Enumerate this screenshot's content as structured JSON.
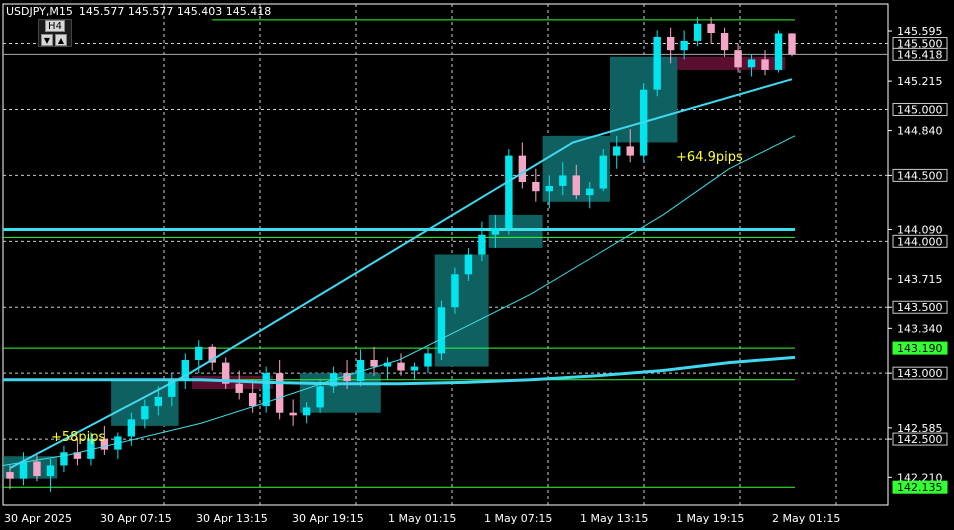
{
  "header": {
    "symbol_line": "USDJPY,M15",
    "ohlc": "145.577 145.577 145.403 145.418"
  },
  "timeframe_box": {
    "label": "H4",
    "down_arrow": "▼",
    "up_arrow": "▲"
  },
  "colors": {
    "background": "#000000",
    "bull_candle": "#00e5ee",
    "bear_candle": "#f4a6c6",
    "ma_fast": "#40d8f0",
    "ma_slow": "#3ae0e8",
    "level_line": "#33ff33",
    "teal_zone": "#0f6060",
    "magenta_zone": "#5a0f30",
    "label_yellow": "#ffff33"
  },
  "annotations": [
    {
      "text": "+58pips"
    },
    {
      "text": "+64.9pips"
    }
  ],
  "chart_data": {
    "type": "candlestick",
    "symbol": "USDJPY",
    "timeframe": "M15",
    "ylim": [
      142.0,
      145.8
    ],
    "price_ticks": [
      "145.595",
      "145.215",
      "144.840",
      "144.500",
      "144.090",
      "143.715",
      "143.500",
      "143.340",
      "143.000",
      "142.585",
      "142.500",
      "142.210"
    ],
    "price_tags": [
      {
        "value": "145.500",
        "style": "box-gray"
      },
      {
        "value": "145.418",
        "style": "box-gray"
      },
      {
        "value": "145.000",
        "style": "box-gray"
      },
      {
        "value": "144.500",
        "style": "box-gray"
      },
      {
        "value": "144.000",
        "style": "box-gray"
      },
      {
        "value": "143.500",
        "style": "box-gray"
      },
      {
        "value": "143.190",
        "style": "box-green"
      },
      {
        "value": "143.000",
        "style": "box-gray"
      },
      {
        "value": "142.500",
        "style": "box-gray"
      },
      {
        "value": "142.135",
        "style": "box-green"
      }
    ],
    "time_labels": [
      "30 Apr 2025",
      "30 Apr 07:15",
      "30 Apr 13:15",
      "30 Apr 19:15",
      "1 May 01:15",
      "1 May 07:15",
      "1 May 13:15",
      "1 May 19:15",
      "2 May 01:15"
    ],
    "levels": [
      {
        "price": 145.68,
        "kind": "green",
        "from": 5
      },
      {
        "price": 144.09,
        "kind": "cyan-thick"
      },
      {
        "price": 144.03,
        "kind": "green"
      },
      {
        "price": 143.19,
        "kind": "green"
      },
      {
        "price": 142.95,
        "kind": "green"
      },
      {
        "price": 142.135,
        "kind": "green"
      }
    ],
    "dashed_levels": [
      145.5,
      145.0,
      144.5,
      144.0,
      143.5,
      143.0,
      142.5
    ],
    "day_separator_x_index": 5,
    "candles_ohlc": [
      [
        142.25,
        142.3,
        142.12,
        142.2
      ],
      [
        142.2,
        142.4,
        142.15,
        142.33
      ],
      [
        142.33,
        142.38,
        142.18,
        142.22
      ],
      [
        142.22,
        142.35,
        142.1,
        142.3
      ],
      [
        142.3,
        142.45,
        142.25,
        142.4
      ],
      [
        142.4,
        142.5,
        142.3,
        142.35
      ],
      [
        142.35,
        142.55,
        142.3,
        142.5
      ],
      [
        142.5,
        142.6,
        142.38,
        142.42
      ],
      [
        142.42,
        142.55,
        142.35,
        142.52
      ],
      [
        142.52,
        142.7,
        142.45,
        142.65
      ],
      [
        142.65,
        142.8,
        142.58,
        142.75
      ],
      [
        142.75,
        142.9,
        142.68,
        142.82
      ],
      [
        142.82,
        143.0,
        142.75,
        142.95
      ],
      [
        142.95,
        143.15,
        142.88,
        143.1
      ],
      [
        143.1,
        143.25,
        143.0,
        143.2
      ],
      [
        143.2,
        143.22,
        143.02,
        143.08
      ],
      [
        143.08,
        143.12,
        142.88,
        142.92
      ],
      [
        142.92,
        143.02,
        142.8,
        142.85
      ],
      [
        142.85,
        142.95,
        142.7,
        142.75
      ],
      [
        142.75,
        143.05,
        142.7,
        143.0
      ],
      [
        143.0,
        143.1,
        142.65,
        142.7
      ],
      [
        142.7,
        142.8,
        142.6,
        142.68
      ],
      [
        142.68,
        142.78,
        142.62,
        142.74
      ],
      [
        142.74,
        142.95,
        142.7,
        142.9
      ],
      [
        142.9,
        143.05,
        142.85,
        143.0
      ],
      [
        143.0,
        143.1,
        142.88,
        142.94
      ],
      [
        142.94,
        143.18,
        142.9,
        143.1
      ],
      [
        143.1,
        143.2,
        142.98,
        143.05
      ],
      [
        143.05,
        143.12,
        142.95,
        143.08
      ],
      [
        143.08,
        143.15,
        142.98,
        143.02
      ],
      [
        143.02,
        143.08,
        142.95,
        143.05
      ],
      [
        143.05,
        143.2,
        143.0,
        143.15
      ],
      [
        143.15,
        143.55,
        143.1,
        143.5
      ],
      [
        143.5,
        143.8,
        143.45,
        143.75
      ],
      [
        143.75,
        143.95,
        143.7,
        143.9
      ],
      [
        143.9,
        144.15,
        143.85,
        144.05
      ],
      [
        144.05,
        144.2,
        143.95,
        144.1
      ],
      [
        144.1,
        144.7,
        144.05,
        144.65
      ],
      [
        144.65,
        144.75,
        144.4,
        144.45
      ],
      [
        144.45,
        144.55,
        144.3,
        144.38
      ],
      [
        144.38,
        144.5,
        144.25,
        144.42
      ],
      [
        144.42,
        144.6,
        144.35,
        144.5
      ],
      [
        144.5,
        144.58,
        144.32,
        144.35
      ],
      [
        144.35,
        144.45,
        144.25,
        144.4
      ],
      [
        144.4,
        144.7,
        144.38,
        144.65
      ],
      [
        144.65,
        144.8,
        144.55,
        144.72
      ],
      [
        144.72,
        144.85,
        144.6,
        144.65
      ],
      [
        144.65,
        145.2,
        144.6,
        145.15
      ],
      [
        145.15,
        145.6,
        145.1,
        145.55
      ],
      [
        145.55,
        145.62,
        145.35,
        145.45
      ],
      [
        145.45,
        145.6,
        145.38,
        145.52
      ],
      [
        145.52,
        145.7,
        145.48,
        145.65
      ],
      [
        145.65,
        145.7,
        145.5,
        145.58
      ],
      [
        145.58,
        145.62,
        145.4,
        145.45
      ],
      [
        145.45,
        145.5,
        145.28,
        145.32
      ],
      [
        145.32,
        145.42,
        145.25,
        145.38
      ],
      [
        145.38,
        145.45,
        145.26,
        145.3
      ],
      [
        145.3,
        145.6,
        145.28,
        145.577
      ],
      [
        145.577,
        145.577,
        145.403,
        145.418
      ]
    ],
    "ma_fast": [
      142.95,
      142.95,
      142.95,
      142.95,
      142.93,
      142.92,
      142.92,
      142.93,
      142.95,
      142.98,
      143.02,
      143.08,
      143.12
    ],
    "ma_slow": [
      142.3,
      142.38,
      142.5,
      142.62,
      142.78,
      142.95,
      143.1,
      143.35,
      143.6,
      143.9,
      144.2,
      144.55,
      144.8
    ],
    "trend_line": [
      [
        142.28,
        0
      ],
      [
        143.0,
        0.23
      ],
      [
        144.75,
        0.72
      ],
      [
        145.23,
        1.0
      ]
    ],
    "zones": [
      {
        "kind": "teal",
        "from": 0,
        "to": 3,
        "hi": 142.37,
        "lo": 142.2
      },
      {
        "kind": "teal",
        "from": 8,
        "to": 12,
        "hi": 142.95,
        "lo": 142.6
      },
      {
        "kind": "magenta",
        "from": 14,
        "to": 19,
        "hi": 142.98,
        "lo": 142.88
      },
      {
        "kind": "teal",
        "from": 22,
        "to": 27,
        "hi": 143.0,
        "lo": 142.7
      },
      {
        "kind": "teal",
        "from": 32,
        "to": 35,
        "hi": 143.9,
        "lo": 143.05
      },
      {
        "kind": "teal",
        "from": 36,
        "to": 39,
        "hi": 144.2,
        "lo": 143.95
      },
      {
        "kind": "teal",
        "from": 40,
        "to": 44,
        "hi": 144.8,
        "lo": 144.3
      },
      {
        "kind": "teal",
        "from": 45,
        "to": 49,
        "hi": 145.4,
        "lo": 144.75
      },
      {
        "kind": "magenta",
        "from": 50,
        "to": 57,
        "hi": 145.4,
        "lo": 145.3
      }
    ]
  }
}
